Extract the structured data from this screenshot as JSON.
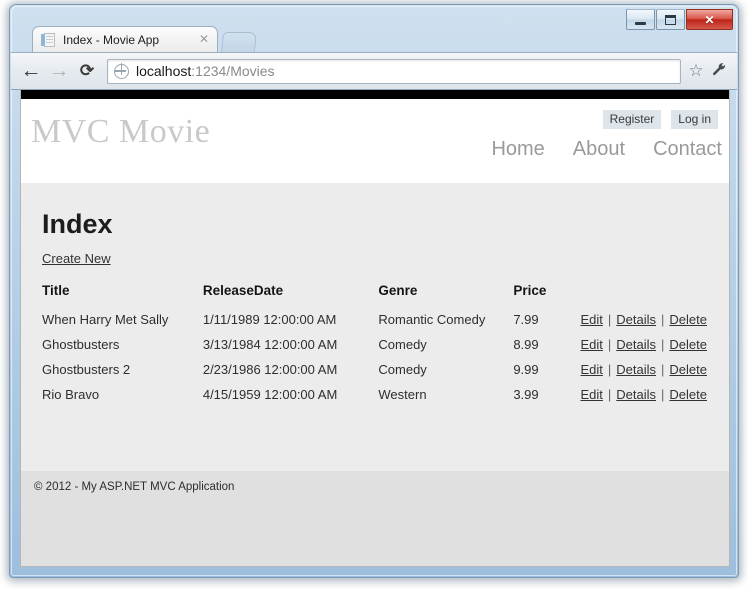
{
  "window": {
    "minimize_label": "Minimize",
    "maximize_label": "Maximize",
    "close_label": "✕"
  },
  "browser": {
    "tab": {
      "title": "Index - Movie App",
      "close_label": "✕",
      "favicon": "page-icon"
    },
    "new_tab_label": "",
    "toolbar": {
      "back_label": "←",
      "forward_label": "→",
      "reload_label": "⟳",
      "bookmark_label": "☆",
      "menu_label": "🔧"
    },
    "omnibox": {
      "host": "localhost",
      "path": ":1234/Movies",
      "site_icon": "globe-icon"
    }
  },
  "site": {
    "brand": "MVC Movie",
    "account_links": [
      {
        "label": "Register"
      },
      {
        "label": "Log in"
      }
    ],
    "nav_links": [
      {
        "label": "Home"
      },
      {
        "label": "About"
      },
      {
        "label": "Contact"
      }
    ],
    "footer": "© 2012 - My ASP.NET MVC Application"
  },
  "page": {
    "title": "Index",
    "create_new_label": "Create New",
    "table": {
      "headers": [
        "Title",
        "ReleaseDate",
        "Genre",
        "Price"
      ],
      "action_labels": {
        "edit": "Edit",
        "details": "Details",
        "delete": "Delete",
        "separator": "|"
      },
      "rows": [
        {
          "title": "When Harry Met Sally",
          "release_date": "1/11/1989 12:00:00 AM",
          "genre": "Romantic Comedy",
          "price": "7.99"
        },
        {
          "title": "Ghostbusters",
          "release_date": "3/13/1984 12:00:00 AM",
          "genre": "Comedy",
          "price": "8.99"
        },
        {
          "title": "Ghostbusters 2",
          "release_date": "2/23/1986 12:00:00 AM",
          "genre": "Comedy",
          "price": "9.99"
        },
        {
          "title": "Rio Bravo",
          "release_date": "4/15/1959 12:00:00 AM",
          "genre": "Western",
          "price": "3.99"
        }
      ]
    }
  },
  "colors": {
    "site_topbar": "#000000",
    "page_background": "#ececec",
    "footer_background": "#e0e0e0",
    "brand_text": "#c9c9c9",
    "nav_text": "#9a9a9a",
    "account_chip": "#dde4ea",
    "close_button": "#bc2418"
  }
}
